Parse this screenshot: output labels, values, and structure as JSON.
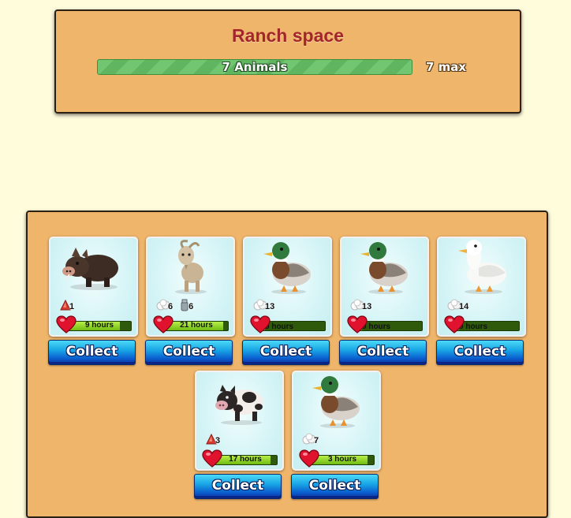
{
  "ranch": {
    "title": "Ranch space",
    "progress_label": "7 Animals",
    "progress_fraction": 1.0,
    "max_label": "7 max"
  },
  "collect_label": "Collect",
  "animals": [
    {
      "animal": "boar",
      "products": [
        {
          "icon": "red-cone-icon",
          "count": "1"
        }
      ],
      "time": "9 hours",
      "progress": 0.82
    },
    {
      "animal": "goat",
      "products": [
        {
          "icon": "wool-icon",
          "count": "6"
        },
        {
          "icon": "milk-can-icon",
          "count": "6"
        }
      ],
      "time": "21 hours",
      "progress": 0.92
    },
    {
      "animal": "mallard",
      "products": [
        {
          "icon": "wool-icon",
          "count": "13"
        }
      ],
      "time": "0 hours",
      "progress": 0.05,
      "wrapped": true
    },
    {
      "animal": "mallard",
      "products": [
        {
          "icon": "wool-icon",
          "count": "13"
        }
      ],
      "time": "0 hours",
      "progress": 0.05,
      "wrapped": true
    },
    {
      "animal": "white-duck",
      "products": [
        {
          "icon": "wool-icon",
          "count": "14"
        }
      ],
      "time": "0 hours",
      "progress": 0.05,
      "wrapped": true
    },
    {
      "animal": "cow-pig",
      "products": [
        {
          "icon": "red-cone-icon",
          "count": "3"
        }
      ],
      "time": "17 hours",
      "progress": 0.9
    },
    {
      "animal": "mallard",
      "products": [
        {
          "icon": "wool-icon",
          "count": "7"
        }
      ],
      "time": "3 hours",
      "progress": 0.9
    }
  ],
  "colors": {
    "accent_title": "#a3272a",
    "panel": "#efb56a",
    "background": "#fffcdc",
    "bar_green": "#6ac36a",
    "button_blue": "#0b5fcf"
  }
}
